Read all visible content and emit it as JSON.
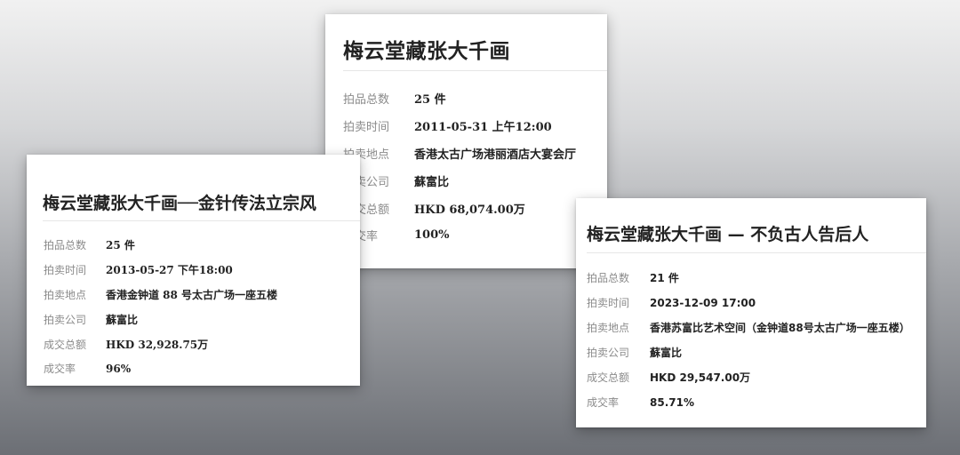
{
  "auctions": [
    {
      "title": "梅云堂藏张大千画",
      "fields": [
        {
          "label": "拍品总数",
          "value": "25 件"
        },
        {
          "label": "拍卖时间",
          "value": "2011-05-31 上午12:00"
        },
        {
          "label": "拍卖地点",
          "value": "香港太古广场港丽酒店大宴会厅"
        },
        {
          "label": "拍卖公司",
          "value": "蘇富比"
        },
        {
          "label": "成交总额",
          "value": "HKD 68,074.00万"
        },
        {
          "label": "成交率",
          "value": "100%"
        }
      ]
    },
    {
      "title": "梅云堂藏张大千画──金针传法立宗风",
      "fields": [
        {
          "label": "拍品总数",
          "value": "25 件"
        },
        {
          "label": "拍卖时间",
          "value": "2013-05-27 下午18:00"
        },
        {
          "label": "拍卖地点",
          "value": "香港金钟道 88 号太古广场一座五楼"
        },
        {
          "label": "拍卖公司",
          "value": "蘇富比"
        },
        {
          "label": "成交总额",
          "value": "HKD 32,928.75万"
        },
        {
          "label": "成交率",
          "value": "96%"
        }
      ]
    },
    {
      "title": "梅云堂藏张大千画 — 不负古人告后人",
      "fields": [
        {
          "label": "拍品总数",
          "value": "21 件"
        },
        {
          "label": "拍卖时间",
          "value": "2023-12-09 17:00"
        },
        {
          "label": "拍卖地点",
          "value": "香港苏富比艺术空间（金钟道88号太古广场一座五楼）"
        },
        {
          "label": "拍卖公司",
          "value": "蘇富比"
        },
        {
          "label": "成交总额",
          "value": "HKD 29,547.00万"
        },
        {
          "label": "成交率",
          "value": "85.71%"
        }
      ]
    }
  ]
}
